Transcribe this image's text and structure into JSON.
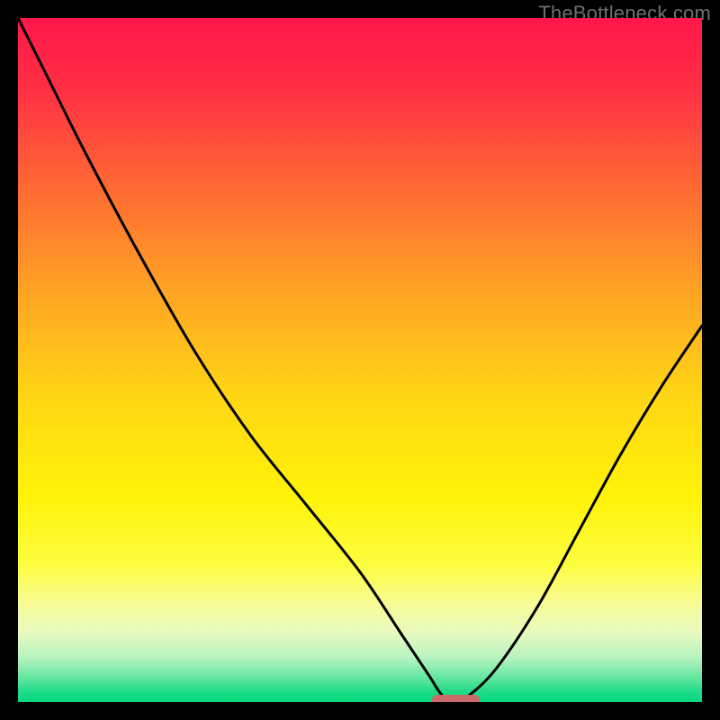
{
  "watermark": "TheBottleneck.com",
  "chart_data": {
    "type": "line",
    "title": "",
    "xlabel": "",
    "ylabel": "",
    "xlim": [
      0,
      100
    ],
    "ylim": [
      0,
      100
    ],
    "series": [
      {
        "name": "curve",
        "x": [
          0,
          4,
          10,
          18,
          26,
          34,
          42,
          50,
          56,
          60,
          62,
          64,
          66,
          70,
          76,
          82,
          88,
          94,
          100
        ],
        "y": [
          100,
          92,
          80,
          65,
          51,
          39,
          29,
          19,
          10,
          4,
          1,
          0,
          1,
          5,
          14,
          25,
          36,
          46,
          55
        ]
      }
    ],
    "marker": {
      "x_center": 64,
      "x_halfwidth": 3.5,
      "y": 0
    },
    "gradient_stops": [
      {
        "offset": 0.0,
        "color": "#ff174a"
      },
      {
        "offset": 0.1,
        "color": "#ff2e44"
      },
      {
        "offset": 0.25,
        "color": "#ff6a33"
      },
      {
        "offset": 0.4,
        "color": "#ffa424"
      },
      {
        "offset": 0.55,
        "color": "#ffd514"
      },
      {
        "offset": 0.7,
        "color": "#fff308"
      },
      {
        "offset": 0.8,
        "color": "#fdfd40"
      },
      {
        "offset": 0.86,
        "color": "#f7fc9a"
      },
      {
        "offset": 0.9,
        "color": "#e6fac0"
      },
      {
        "offset": 0.935,
        "color": "#b7f3c0"
      },
      {
        "offset": 0.965,
        "color": "#62e6a0"
      },
      {
        "offset": 0.985,
        "color": "#1fdc88"
      },
      {
        "offset": 1.0,
        "color": "#06d97f"
      }
    ],
    "marker_color": "#cc6a6a",
    "curve_color": "#000000"
  }
}
